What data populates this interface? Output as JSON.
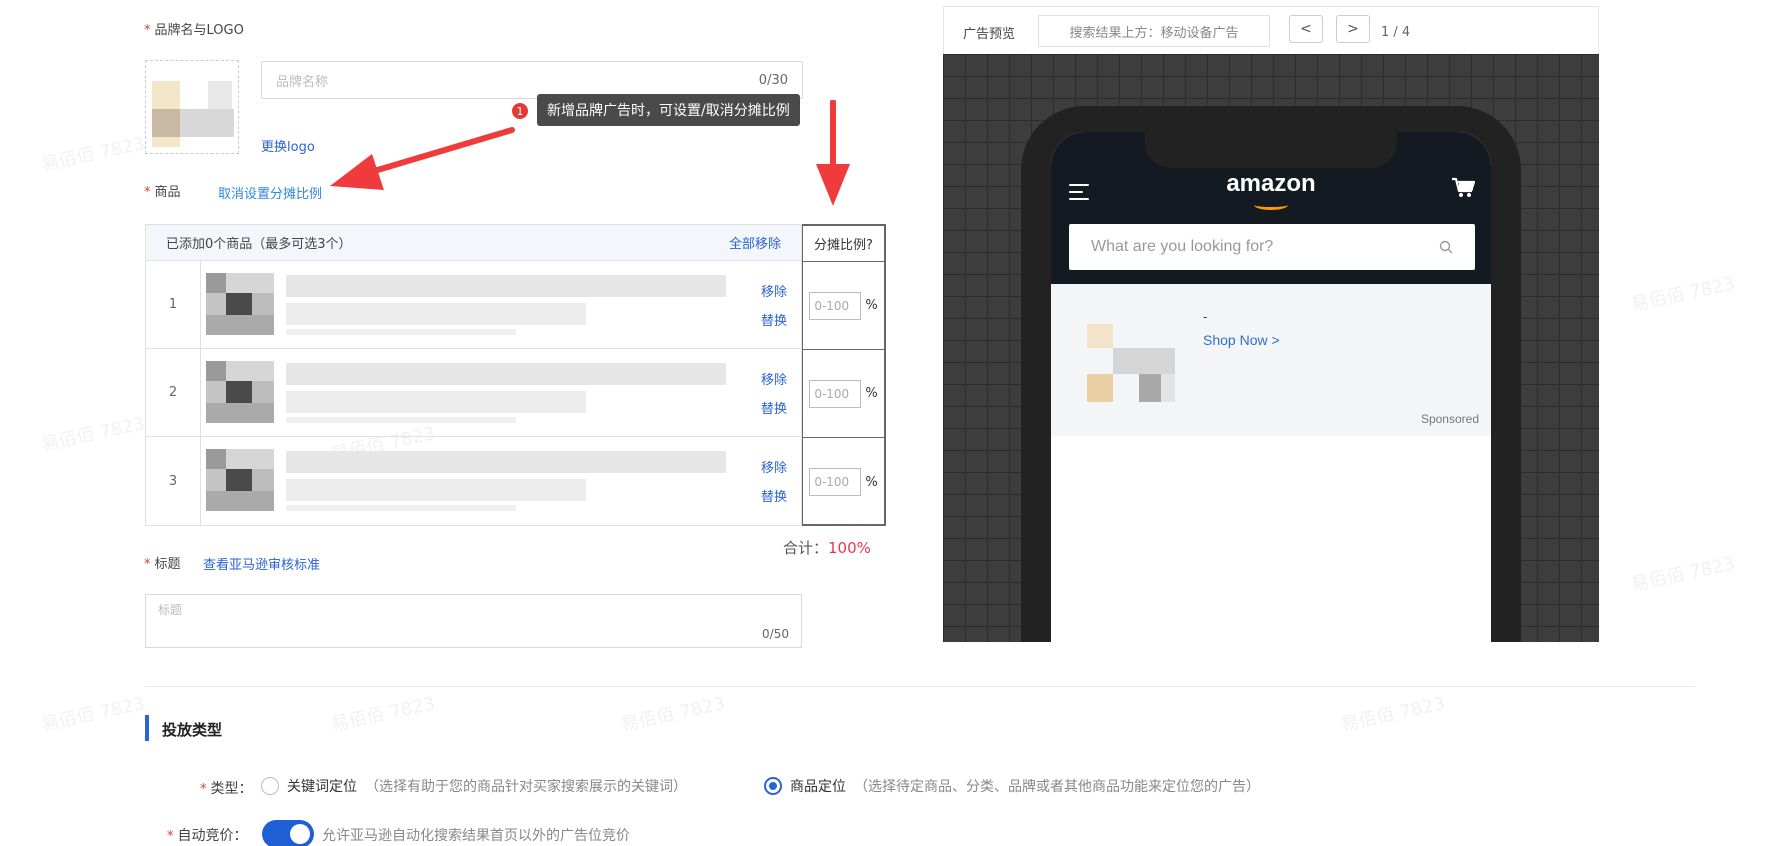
{
  "brand": {
    "label": "品牌名与LOGO",
    "name_placeholder": "品牌名称",
    "name_count": "0/30",
    "change_logo": "更换logo"
  },
  "tooltip": {
    "step": "1",
    "text": "新增品牌广告时，可设置/取消分摊比例"
  },
  "goods": {
    "label": "商品",
    "cancel_ratio": "取消设置分摊比例",
    "table_header": "已添加0个商品（最多可选3个）",
    "remove_all": "全部移除",
    "ratio_header": "分摊比例?",
    "rows": [
      {
        "index": "1",
        "remove": "移除",
        "replace": "替换",
        "ratio_placeholder": "0-100",
        "unit": "%"
      },
      {
        "index": "2",
        "remove": "移除",
        "replace": "替换",
        "ratio_placeholder": "0-100",
        "unit": "%"
      },
      {
        "index": "3",
        "remove": "移除",
        "replace": "替换",
        "ratio_placeholder": "0-100",
        "unit": "%"
      }
    ],
    "total_label": "合计：",
    "total_value": "100%"
  },
  "title_field": {
    "label": "标题",
    "review_link": "查看亚马逊审核标准",
    "placeholder": "标题",
    "count": "0/50"
  },
  "preview": {
    "label": "广告预览",
    "placement": "搜索结果上方：移动设备广告",
    "page": "1 / 4",
    "prev": "<",
    "next": ">",
    "app": {
      "logo": "amazon",
      "search_placeholder": "What are you looking for?",
      "ad_title": "-",
      "shop_now": "Shop Now >",
      "sponsored": "Sponsored"
    }
  },
  "placement": {
    "section_title": "投放类型",
    "type_label": "类型：",
    "options": [
      {
        "label": "关键词定位",
        "hint": "（选择有助于您的商品针对买家搜索展示的关键词）",
        "checked": false
      },
      {
        "label": "商品定位",
        "hint": "（选择待定商品、分类、品牌或者其他商品功能来定位您的广告）",
        "checked": true
      }
    ],
    "auto_bid_label": "自动竞价：",
    "auto_bid_on": true,
    "auto_bid_hint": "允许亚马逊自动化搜索结果首页以外的广告位竞价"
  },
  "watermark": "易佰佰 7823",
  "colors": {
    "accent": "#2b63d6",
    "required": "#e53935",
    "total": "#e53950"
  }
}
